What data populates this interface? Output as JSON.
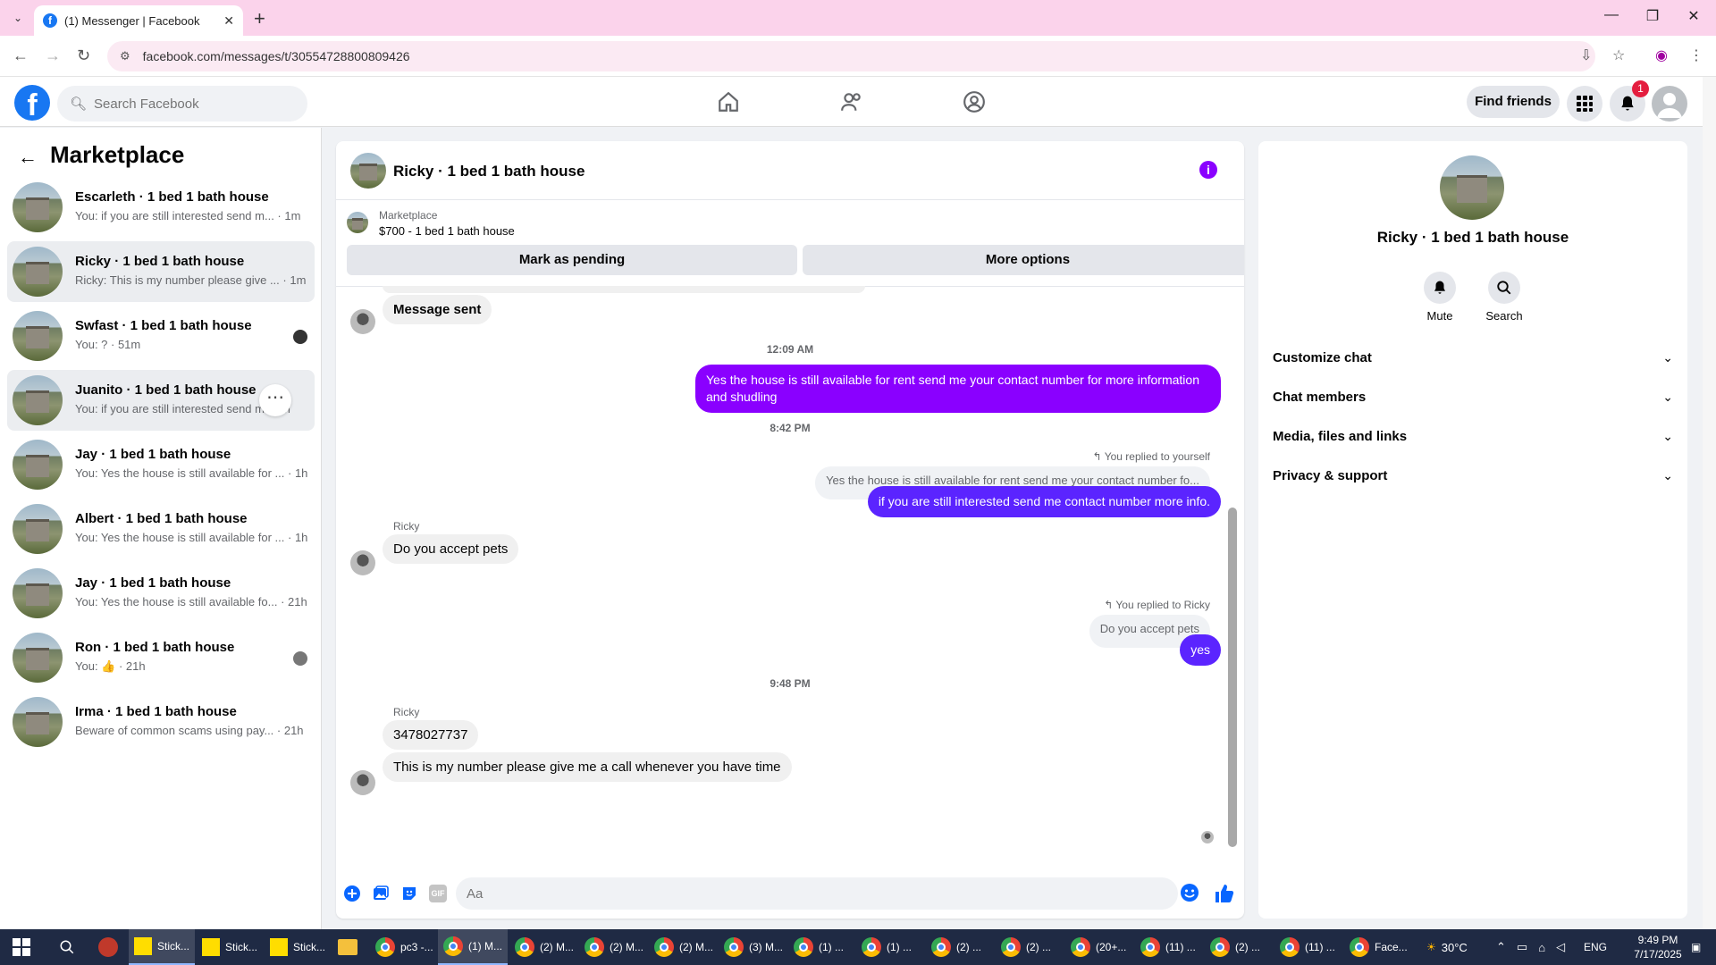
{
  "browser": {
    "tab_title": "(1) Messenger | Facebook",
    "url": "facebook.com/messages/t/30554728800809426"
  },
  "fb_header": {
    "search_placeholder": "Search Facebook",
    "find_friends": "Find friends",
    "notification_count": "1"
  },
  "sidebar": {
    "title": "Marketplace",
    "conversations": [
      {
        "name": "Escarleth · 1 bed 1 bath house",
        "preview": "You: if you are still interested send m... · 1m"
      },
      {
        "name": "Ricky · 1 bed 1 bath house",
        "preview": "Ricky: This is my number please give ... · 1m"
      },
      {
        "name": "Swfast · 1 bed 1 bath house",
        "preview": "You: ? · 51m"
      },
      {
        "name": "Juanito · 1 bed 1 bath house",
        "preview": "You: if you are still interested send m... 1h"
      },
      {
        "name": "Jay · 1 bed 1 bath house",
        "preview": "You: Yes the house is still available for ... · 1h"
      },
      {
        "name": "Albert · 1 bed 1 bath house",
        "preview": "You: Yes the house is still available for ... · 1h"
      },
      {
        "name": "Jay · 1 bed 1 bath house",
        "preview": "You: Yes the house is still available fo... · 21h"
      },
      {
        "name": "Ron · 1 bed 1 bath house",
        "preview": "You: 👍 · 21h"
      },
      {
        "name": "Irma · 1 bed 1 bath house",
        "preview": "Beware of common scams using pay... · 21h"
      }
    ]
  },
  "chat": {
    "title": "Ricky · 1 bed 1 bath house",
    "marketplace_label": "Marketplace",
    "listing": "$700 - 1 bed 1 bath house",
    "mark_pending": "Mark as pending",
    "more_options": "More options",
    "messages": {
      "m1": "Message sent",
      "t1": "12:09 AM",
      "m2": "Yes the house is still available for rent send me your contact number for more information and shudling",
      "t2": "8:42 PM",
      "reply1_note": "You replied to yourself",
      "reply1_quote": "Yes the house is still available for rent send me your contact number fo...",
      "m3": "if you  are still interested send me contact number more info.",
      "sender1": "Ricky",
      "m4": "Do you accept pets",
      "reply2_note": "You replied to Ricky",
      "reply2_quote": "Do you accept pets",
      "m5": "yes",
      "t3": "9:48 PM",
      "sender2": "Ricky",
      "m6": "3478027737",
      "m7": "This is my number please give me a call whenever you have time"
    },
    "composer_placeholder": "Aa",
    "gif_label": "GIF"
  },
  "info_panel": {
    "name": "Ricky · 1 bed 1 bath house",
    "mute": "Mute",
    "search": "Search",
    "sections": [
      "Customize chat",
      "Chat members",
      "Media, files and links",
      "Privacy & support"
    ]
  },
  "taskbar": {
    "items": [
      "Stick...",
      "Stick...",
      "Stick...",
      "pc3 -...",
      "(1) M...",
      "(2) M...",
      "(2) M...",
      "(2) M...",
      "(3) M...",
      "(1) ...",
      "(1) ...",
      "(2) ...",
      "(2) ...",
      "(20+...",
      "(11) ...",
      "(2) ...",
      "(11) ...",
      "Face..."
    ],
    "temperature": "30°C",
    "language": "ENG",
    "time": "9:49 PM",
    "date": "7/17/2025"
  },
  "colors": {
    "brand_blue": "#1877f2",
    "outgoing_purple": "#8a00ff",
    "outgoing_blue": "#5b24ff",
    "tab_pink": "#fbd3eb"
  }
}
